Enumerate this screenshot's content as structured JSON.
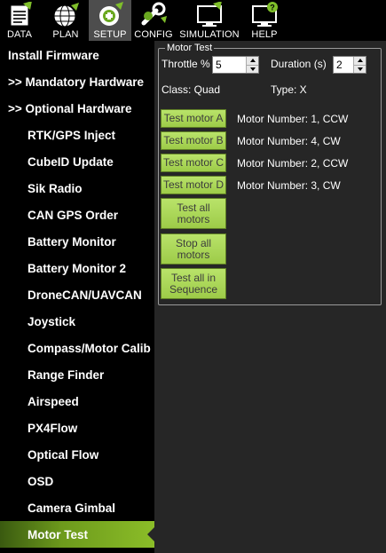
{
  "toolbar": {
    "items": [
      {
        "label": "DATA",
        "icon": "data-icon"
      },
      {
        "label": "PLAN",
        "icon": "globe-icon"
      },
      {
        "label": "SETUP",
        "icon": "gear-icon",
        "active": true
      },
      {
        "label": "CONFIG",
        "icon": "wrench-icon"
      },
      {
        "label": "SIMULATION",
        "icon": "monitor-icon"
      },
      {
        "label": "HELP",
        "icon": "help-icon"
      }
    ]
  },
  "sidebar": {
    "items": [
      {
        "label": "Install Firmware"
      },
      {
        "label": ">> Mandatory Hardware"
      },
      {
        "label": ">> Optional Hardware"
      },
      {
        "label": "RTK/GPS Inject"
      },
      {
        "label": "CubeID Update"
      },
      {
        "label": "Sik Radio"
      },
      {
        "label": "CAN GPS Order"
      },
      {
        "label": "Battery Monitor"
      },
      {
        "label": "Battery Monitor 2"
      },
      {
        "label": "DroneCAN/UAVCAN"
      },
      {
        "label": "Joystick"
      },
      {
        "label": "Compass/Motor Calib"
      },
      {
        "label": "Range Finder"
      },
      {
        "label": "Airspeed"
      },
      {
        "label": "PX4Flow"
      },
      {
        "label": "Optical Flow"
      },
      {
        "label": "OSD"
      },
      {
        "label": "Camera Gimbal"
      },
      {
        "label": "Motor Test",
        "selected": true
      }
    ]
  },
  "motor_test": {
    "group_title": "Motor Test",
    "throttle_label": "Throttle %",
    "throttle_value": "5",
    "duration_label": "Duration (s)",
    "duration_value": "2",
    "class_label": "Class: Quad",
    "type_label": "Type: X",
    "motors": [
      {
        "button": "Test motor A",
        "info": "Motor Number: 1, CCW"
      },
      {
        "button": "Test motor B",
        "info": "Motor Number: 4, CW"
      },
      {
        "button": "Test motor C",
        "info": "Motor Number: 2, CCW"
      },
      {
        "button": "Test motor D",
        "info": "Motor Number: 3, CW"
      }
    ],
    "test_all_label": "Test all motors",
    "stop_all_label": "Stop all motors",
    "test_sequence_label": "Test all in Sequence"
  },
  "colors": {
    "accent_green": "#9dcb48",
    "selected_gradient_end": "#8bbd28",
    "panel_bg": "#262626"
  }
}
